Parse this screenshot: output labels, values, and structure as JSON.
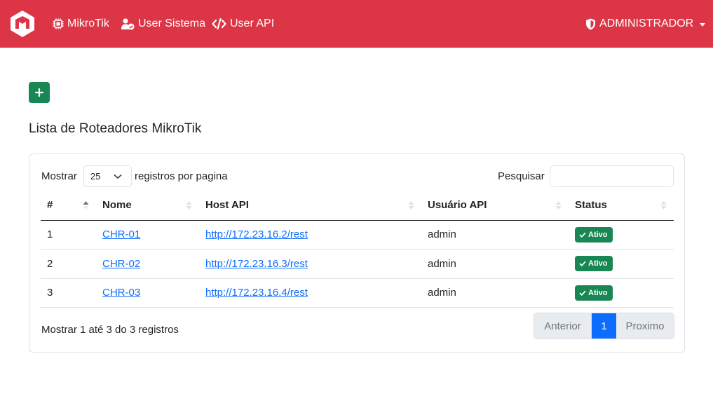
{
  "nav": {
    "logo": "mikrotik-logo",
    "links": [
      {
        "label": "MikroTik",
        "icon": "chip-icon"
      },
      {
        "label": "User Sistema",
        "icon": "user-check-icon"
      },
      {
        "label": "User API",
        "icon": "code-icon"
      }
    ],
    "user_menu": {
      "label": "ADMINISTRADOR",
      "icon": "shield-icon"
    }
  },
  "colors": {
    "navbar": "#dc3545",
    "success": "#198754",
    "primary": "#0d6efd"
  },
  "add_button": {
    "label": "+"
  },
  "page_title": "Lista de Roteadores MikroTik",
  "table_controls": {
    "length_prefix": "Mostrar",
    "length_value": "25",
    "length_suffix": "registros por pagina",
    "search_label": "Pesquisar",
    "search_value": ""
  },
  "table": {
    "columns": [
      "#",
      "Nome",
      "Host API",
      "Usuário API",
      "Status"
    ],
    "rows": [
      {
        "id": "1",
        "nome": "CHR-01",
        "host": "http://172.23.16.2/rest",
        "usuario": "admin",
        "status": "Ativo"
      },
      {
        "id": "2",
        "nome": "CHR-02",
        "host": "http://172.23.16.3/rest",
        "usuario": "admin",
        "status": "Ativo"
      },
      {
        "id": "3",
        "nome": "CHR-03",
        "host": "http://172.23.16.4/rest",
        "usuario": "admin",
        "status": "Ativo"
      }
    ]
  },
  "footer": {
    "info": "Mostrar 1 até 3 do 3 registros",
    "pagination": {
      "prev": "Anterior",
      "current": "1",
      "next": "Proximo"
    }
  }
}
